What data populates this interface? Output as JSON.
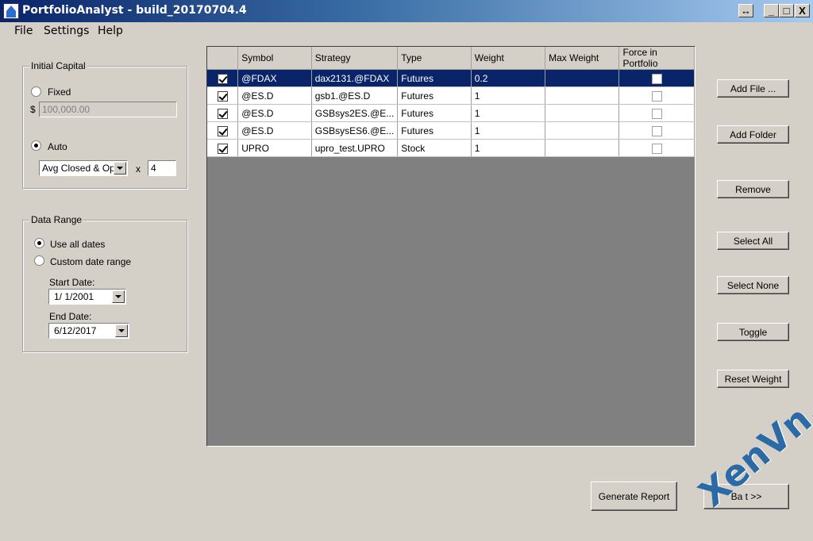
{
  "window": {
    "title": "PortfolioAnalyst - build_20170704.4",
    "buttons": [
      "↔",
      "_",
      "□",
      "X"
    ]
  },
  "menu": [
    "File",
    "Settings",
    "Help"
  ],
  "initial_capital": {
    "title": "Initial Capital",
    "fixed_label": "Fixed",
    "currency_symbol": "$",
    "fixed_value": "100,000.00",
    "auto_label": "Auto",
    "mode_selected": "auto",
    "auto_method": "Avg Closed & Open",
    "multiplier_label": "x",
    "multiplier_value": "4"
  },
  "data_range": {
    "title": "Data Range",
    "use_all_label": "Use all dates",
    "custom_label": "Custom date range",
    "mode_selected": "use_all",
    "start_label": "Start Date:",
    "start_value": "1/  1/2001",
    "end_label": "End Date:",
    "end_value": "6/12/2017"
  },
  "grid": {
    "columns": [
      "",
      "Symbol",
      "Strategy",
      "Type",
      "Weight",
      "Max Weight",
      "Force in Portfolio"
    ],
    "rows": [
      {
        "checked": true,
        "symbol": "@FDAX",
        "strategy": "dax2131.@FDAX",
        "type": "Futures",
        "weight": "0.2",
        "max_weight": "",
        "force": false,
        "selected": true
      },
      {
        "checked": true,
        "symbol": "@ES.D",
        "strategy": "gsb1.@ES.D",
        "type": "Futures",
        "weight": "1",
        "max_weight": "",
        "force": false,
        "selected": false
      },
      {
        "checked": true,
        "symbol": "@ES.D",
        "strategy": "GSBsys2ES.@E...",
        "type": "Futures",
        "weight": "1",
        "max_weight": "",
        "force": false,
        "selected": false
      },
      {
        "checked": true,
        "symbol": "@ES.D",
        "strategy": "GSBsysES6.@E...",
        "type": "Futures",
        "weight": "1",
        "max_weight": "",
        "force": false,
        "selected": false
      },
      {
        "checked": true,
        "symbol": "UPRO",
        "strategy": "upro_test.UPRO",
        "type": "Stock",
        "weight": "1",
        "max_weight": "",
        "force": false,
        "selected": false
      }
    ]
  },
  "side_buttons": {
    "add_file": "Add File ...",
    "add_folder": "Add Folder",
    "remove": "Remove",
    "select_all": "Select All",
    "select_none": "Select None",
    "toggle": "Toggle",
    "reset_weight": "Reset Weight"
  },
  "bottom_buttons": {
    "generate_report": "Generate Report",
    "back_next": "Ba       t >>"
  },
  "watermark": "XenVn.Com"
}
